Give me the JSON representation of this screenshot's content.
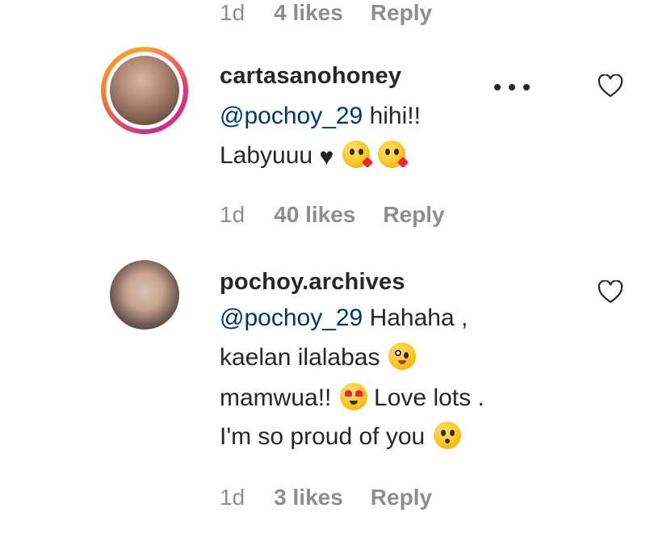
{
  "comments": [
    {
      "meta": {
        "time": "1d",
        "likes": "4 likes",
        "reply": "Reply"
      }
    },
    {
      "username": "cartasanohoney",
      "mention": "@pochoy_29",
      "line1_rest": " hihi!!",
      "line2": "Labyuuu ",
      "meta": {
        "time": "1d",
        "likes": "40 likes",
        "reply": "Reply"
      }
    },
    {
      "username": "pochoy.archives",
      "mention": "@pochoy_29",
      "line1_rest": " Hahaha ,",
      "line2": "kaelan ilalabas ",
      "line3a": "mamwua!! ",
      "line3b": " Love lots .",
      "line4": "I'm so proud of you ",
      "meta": {
        "time": "1d",
        "likes": "3 likes",
        "reply": "Reply"
      }
    }
  ],
  "icons": {
    "heart": "heart-outline-icon",
    "more": "more-options-icon",
    "emoji_black_heart": "black-heart-emoji",
    "emoji_kiss": "face-blowing-kiss-emoji",
    "emoji_zany": "zany-face-emoji",
    "emoji_heart_eyes": "heart-eyes-emoji",
    "emoji_hushed": "hushed-face-emoji"
  },
  "colors": {
    "text": "#262626",
    "secondary": "#8e8e8e",
    "mention": "#00376b",
    "story_ring": "#e8306e"
  }
}
